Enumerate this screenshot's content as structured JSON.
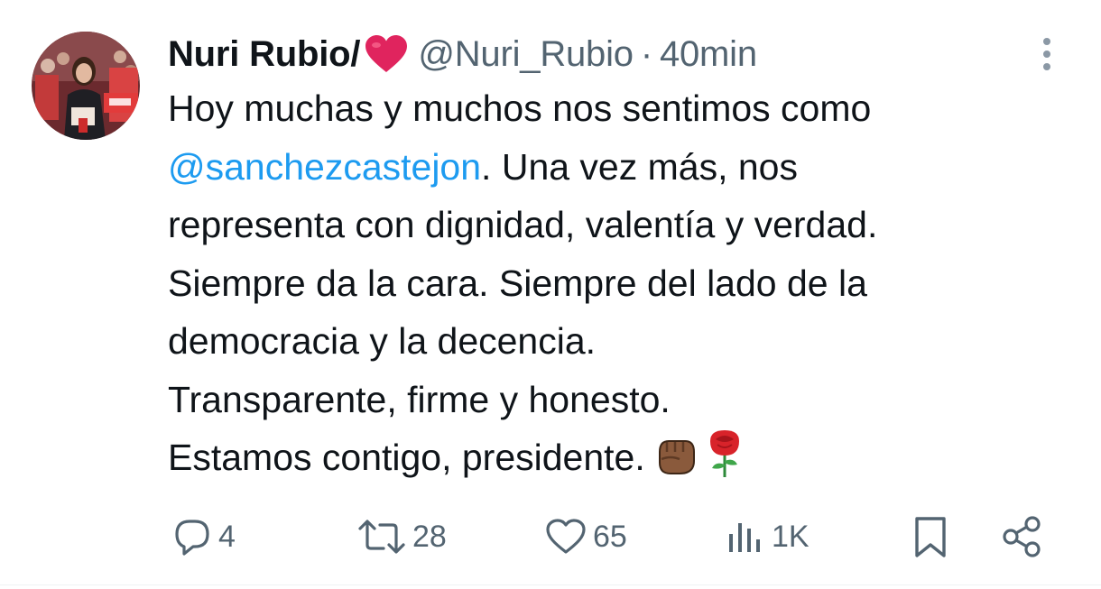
{
  "tweet": {
    "author_name": "Nuri Rubio/",
    "author_name_emoji": "red-heart",
    "handle": "@Nuri_Rubio",
    "separator": "·",
    "time": "40min",
    "body": {
      "line1": "Hoy muchas y muchos nos sentimos como",
      "mention": "@sanchezcastejon",
      "line2_rest": ". Una vez más, nos",
      "line3": "representa con dignidad, valentía y verdad.",
      "line4": "Siempre da la cara. Siempre del lado de la",
      "line5": "democracia y la decencia.",
      "line6": "Transparente, firme y honesto.",
      "line7": "Estamos contigo, presidente.",
      "end_emojis": [
        "raised-fist-medium-dark-skin",
        "rose"
      ]
    }
  },
  "actions": {
    "replies": "4",
    "retweets": "28",
    "likes": "65",
    "views": "1K"
  },
  "colors": {
    "text": "#0f1419",
    "secondary": "#536471",
    "mention": "#1d9bf0",
    "heart": "#e0245e"
  },
  "icons": [
    "reply-icon",
    "retweet-icon",
    "like-icon",
    "views-icon",
    "bookmark-icon",
    "share-icon",
    "more-icon"
  ]
}
